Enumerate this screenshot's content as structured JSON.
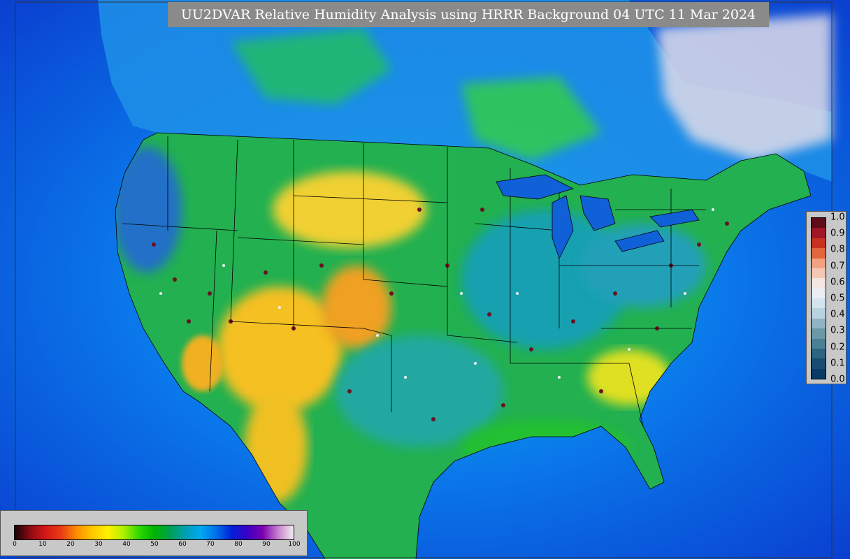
{
  "title": "UU2DVAR Relative Humidity Analysis using HRRR Background 04 UTC 11 Mar 2024",
  "humidity_legend": {
    "ticks": [
      "0",
      "10",
      "20",
      "30",
      "40",
      "50",
      "60",
      "70",
      "80",
      "90",
      "100"
    ],
    "colors": [
      "#120406",
      "#8e0a12",
      "#d41818",
      "#e83c14",
      "#ff8c00",
      "#ffc800",
      "#fff000",
      "#b4f000",
      "#30d800",
      "#00b400",
      "#00a050",
      "#00a0b0",
      "#00a8f0",
      "#0070e8",
      "#0020d8",
      "#3c00c8",
      "#7a00b0",
      "#c880d0",
      "#f0f0f0"
    ]
  },
  "increment_legend": {
    "ticks": [
      "1.0",
      "0.9",
      "0.8",
      "0.7",
      "0.6",
      "0.5",
      "0.4",
      "0.3",
      "0.2",
      "0.1",
      "0.0"
    ],
    "colors": [
      "#5e0c18",
      "#a01626",
      "#c83220",
      "#e0663c",
      "#f2a280",
      "#f4c8b4",
      "#f4e6e0",
      "#eaeef2",
      "#d4e4ee",
      "#b8d2e0",
      "#90b4c4",
      "#6a9aa8",
      "#4a8094",
      "#2c6482",
      "#184c72",
      "#0a3a66"
    ]
  },
  "map": {
    "ocean_color": "#0a64e6",
    "land_base_color": "#2ab84a",
    "border_color": "#000000"
  }
}
